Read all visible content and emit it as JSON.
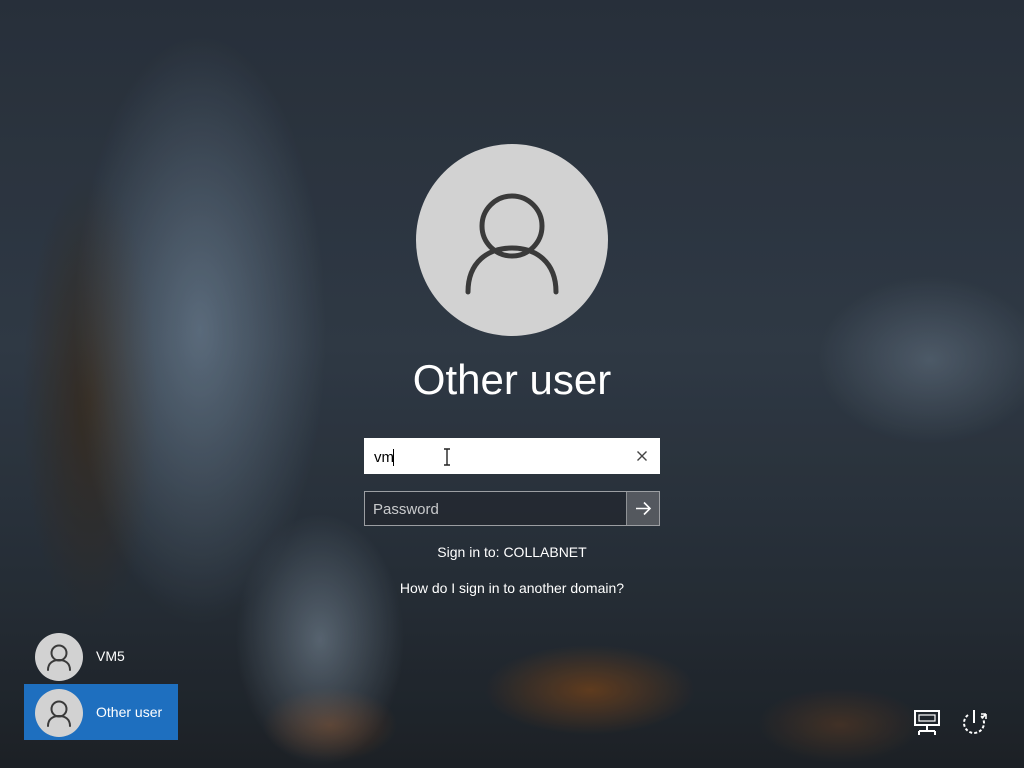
{
  "lock_screen": {
    "user_title": "Other user",
    "username": {
      "value": "vm"
    },
    "password": {
      "placeholder": "Password"
    },
    "sign_in_to": "Sign in to: COLLABNET",
    "domain_help_link": "How do I sign in to another domain?"
  },
  "user_tiles": [
    {
      "label": "VM5",
      "selected": false
    },
    {
      "label": "Other user",
      "selected": true
    }
  ],
  "system_icons": [
    "network-icon",
    "power-icon"
  ],
  "colors": {
    "selected_tile": "#1e6fbf",
    "avatar_bg": "#d2d2d2",
    "avatar_glyph": "#3a3a3a"
  }
}
